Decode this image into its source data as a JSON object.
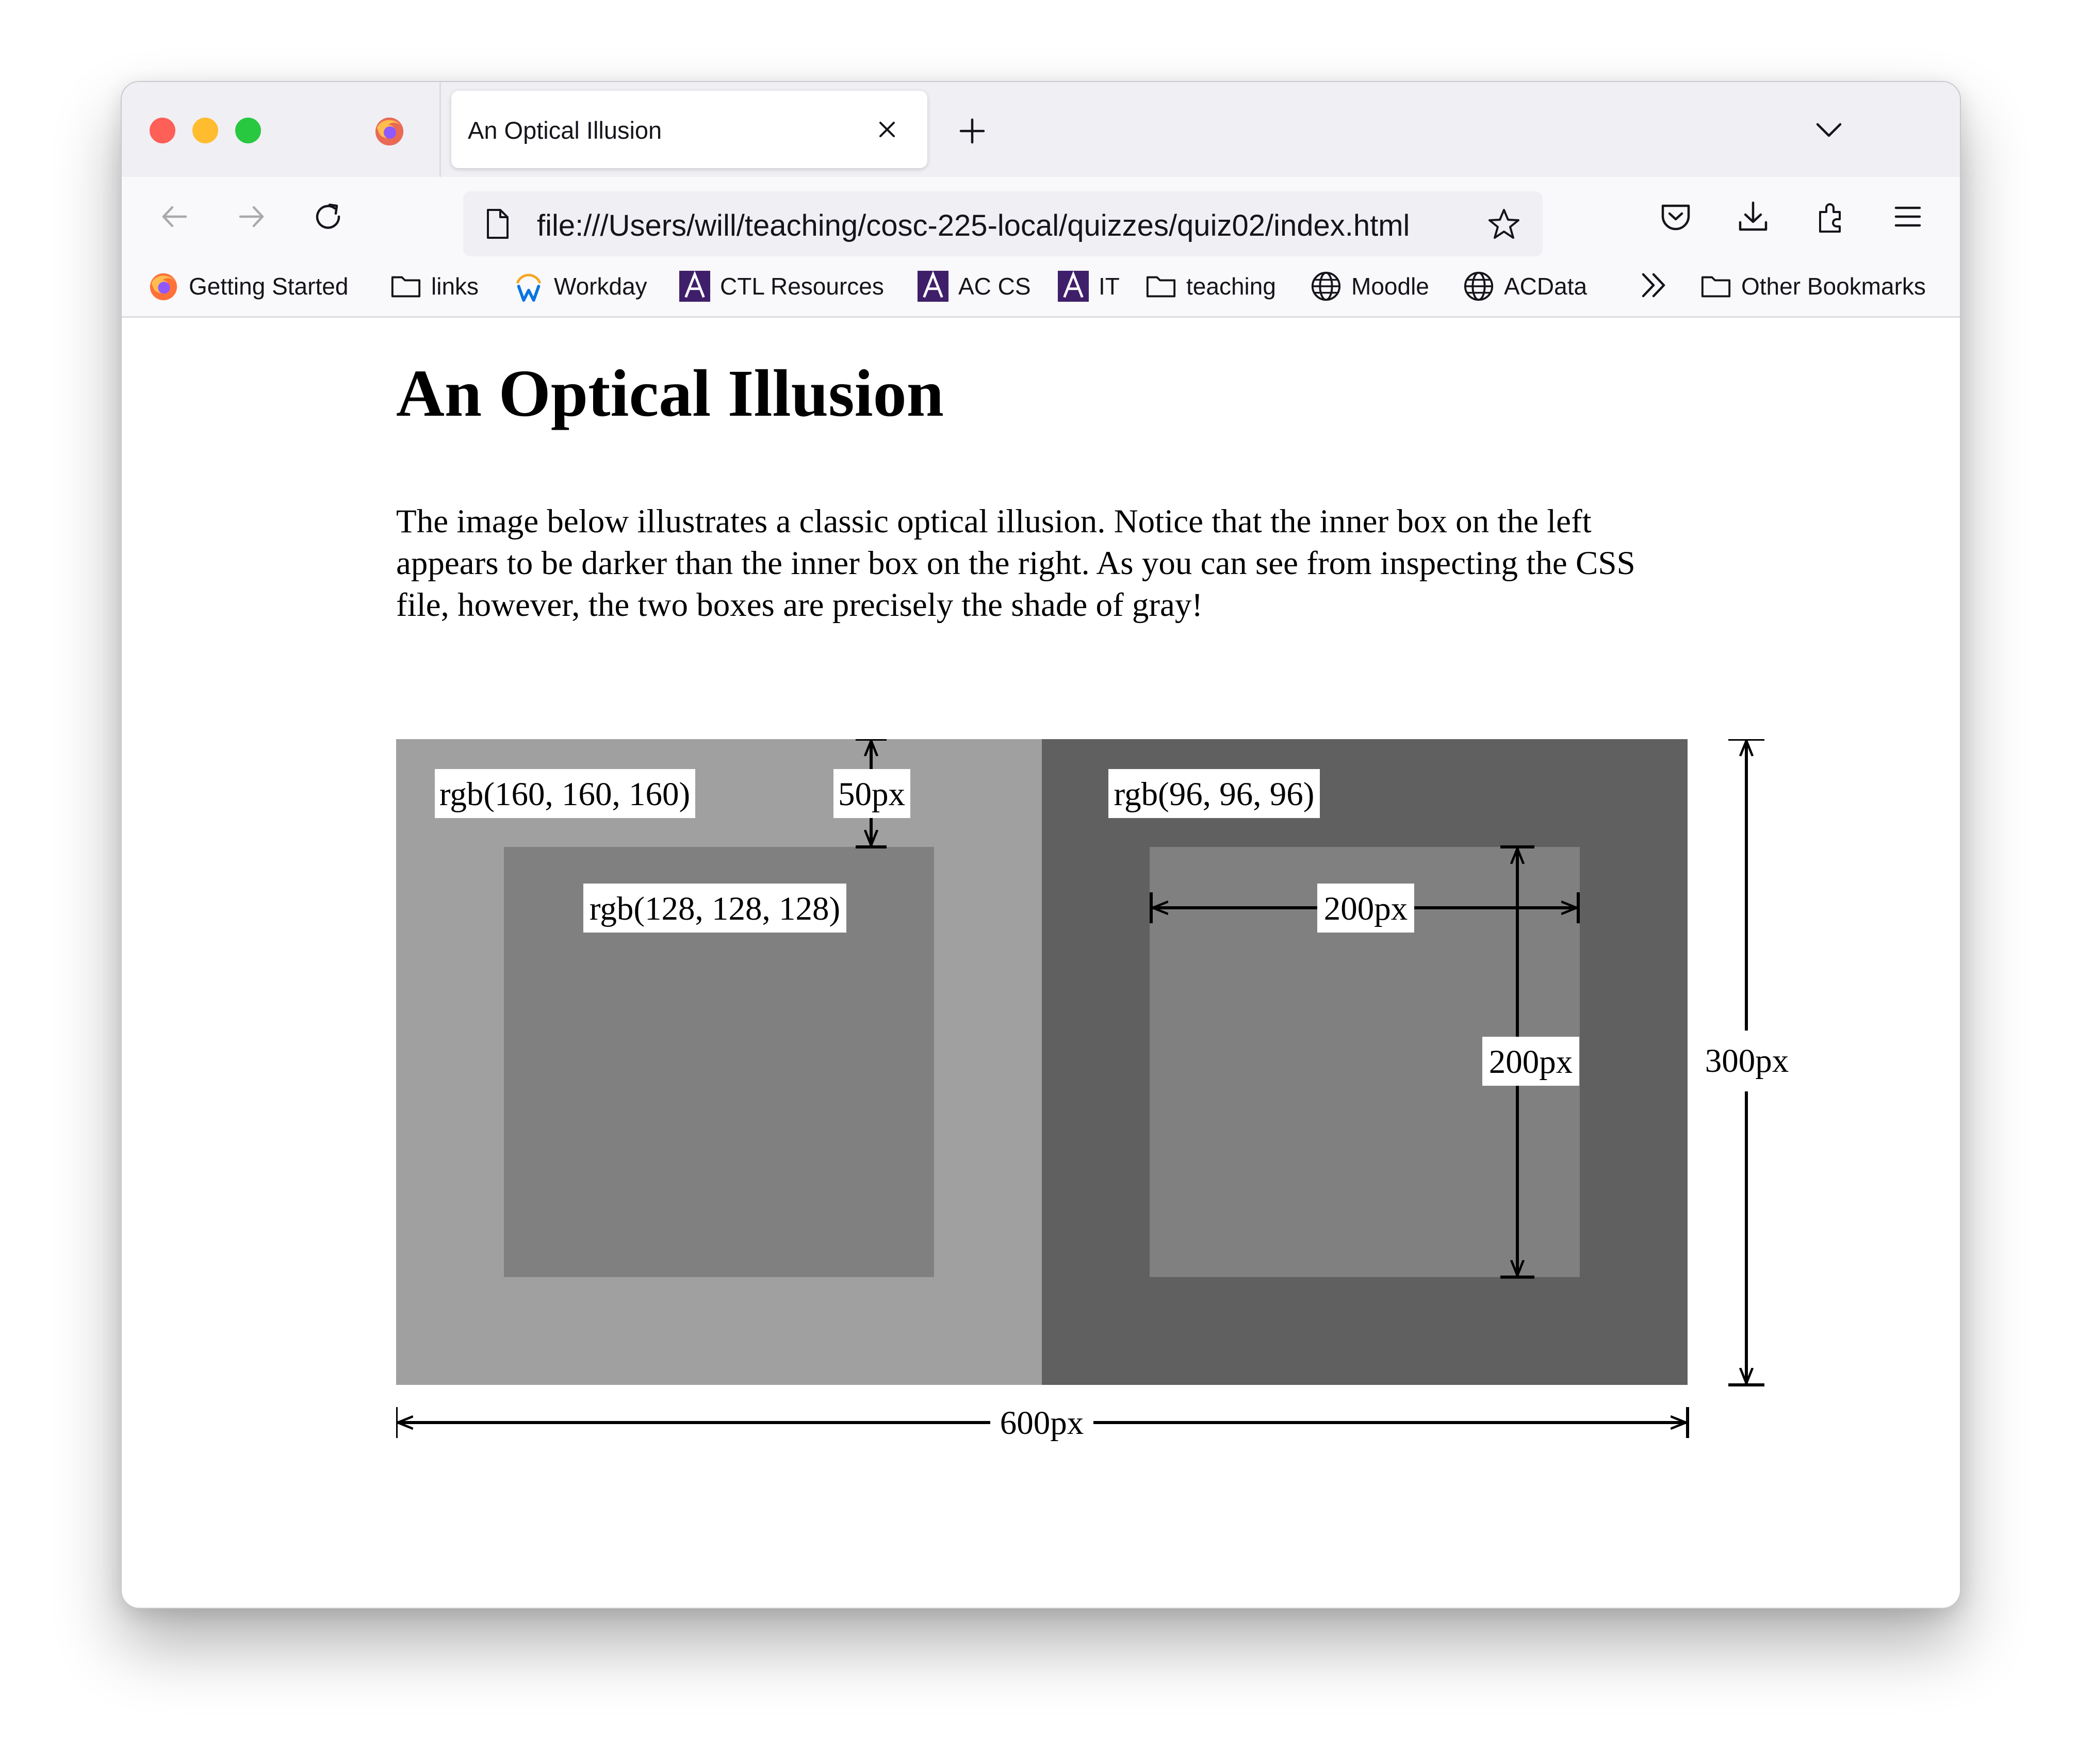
{
  "browser": {
    "tab": {
      "title": "An Optical Illusion"
    },
    "url": "file:///Users/will/teaching/cosc-225-local/quizzes/quiz02/index.html",
    "bookmarks": [
      {
        "label": "Getting Started",
        "icon": "firefox-icon"
      },
      {
        "label": "links",
        "icon": "folder-icon"
      },
      {
        "label": "Workday",
        "icon": "workday-icon"
      },
      {
        "label": "CTL Resources",
        "icon": "amherst-a-icon"
      },
      {
        "label": "AC CS",
        "icon": "amherst-a-icon"
      },
      {
        "label": "IT",
        "icon": "amherst-a-icon"
      },
      {
        "label": "teaching",
        "icon": "folder-icon"
      },
      {
        "label": "Moodle",
        "icon": "globe-icon"
      },
      {
        "label": "ACData",
        "icon": "globe-icon"
      }
    ],
    "other_bookmarks": "Other Bookmarks"
  },
  "page": {
    "title": "An Optical Illusion",
    "intro": "The image below illustrates a classic optical illusion. Notice that the inner box on the left appears to be darker than the inner box on the right. As you can see from inspecting the CSS file, however, the two boxes are precisely the shade of gray!"
  },
  "diagram": {
    "left_outer_label": "rgb(160, 160, 160)",
    "inner_label": "rgb(128, 128, 128)",
    "right_outer_label": "rgb(96, 96, 96)",
    "margin_label": "50px",
    "inner_width_label": "200px",
    "inner_height_label": "200px",
    "total_height_label": "300px",
    "total_width_label": "600px"
  },
  "colors": {
    "left_outer": "#a0a0a0",
    "inner": "#808080",
    "right_outer": "#606060",
    "traffic_red": "#fe5f57",
    "traffic_yellow": "#febc2e",
    "traffic_green": "#28c840",
    "amherst_purple": "#3f1f69"
  }
}
